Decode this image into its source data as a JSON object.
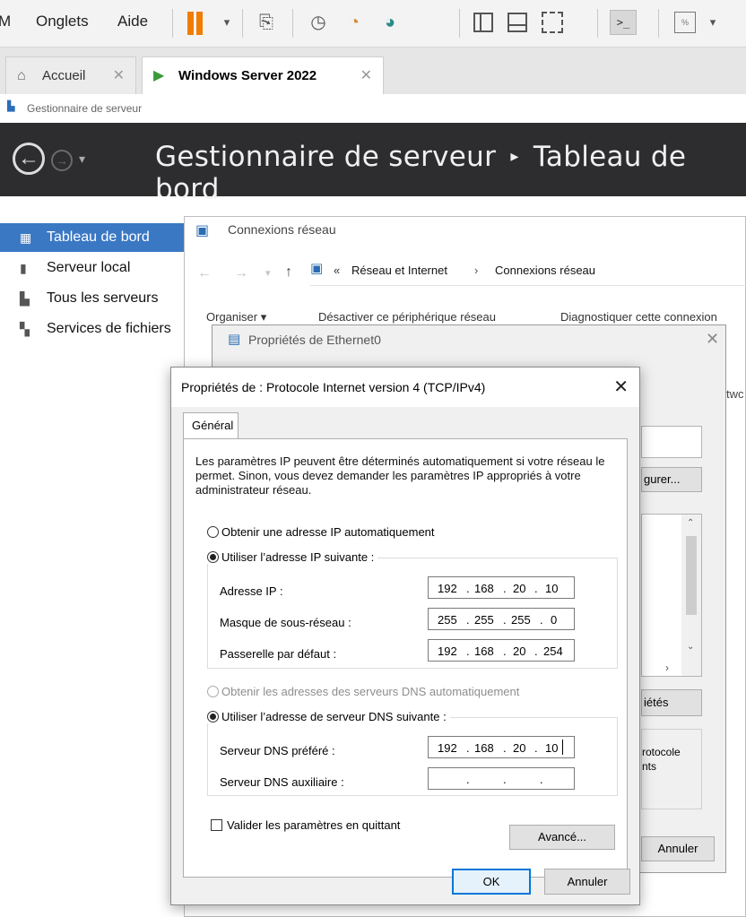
{
  "vmware": {
    "menu": [
      "M",
      "Onglets",
      "Aide"
    ],
    "tabs": [
      {
        "label": "Accueil"
      },
      {
        "label": "Windows Server 2022"
      }
    ]
  },
  "server_manager": {
    "window_title": "Gestionnaire de serveur",
    "title": "Gestionnaire de serveur",
    "separator": "▸",
    "page": "Tableau de bord",
    "sidebar": [
      {
        "label": "Tableau de bord",
        "active": true
      },
      {
        "label": "Serveur local"
      },
      {
        "label": "Tous les serveurs"
      },
      {
        "label": "Services de fichiers"
      }
    ]
  },
  "network_connections": {
    "title": "Connexions réseau",
    "breadcrumb": {
      "prefix": "«",
      "parent": "Réseau et Internet",
      "sep": "›",
      "current": "Connexions réseau"
    },
    "commands": [
      "Organiser ▾",
      "Désactiver ce périphérique réseau",
      "Diagnostiquer cette connexion"
    ],
    "edge_text": "twc"
  },
  "ethernet_props": {
    "title": "Propriétés de Ethernet0",
    "configure_partial": "gurer...",
    "properties_partial": "iétés",
    "desc_partial_1": "rotocole",
    "desc_partial_2": "nts",
    "cancel": "Annuler"
  },
  "ipv4": {
    "title": "Propriétés de : Protocole Internet version 4 (TCP/IPv4)",
    "tab": "Général",
    "description": "Les paramètres IP peuvent être déterminés automatiquement si votre réseau le permet. Sinon, vous devez demander les paramètres IP appropriés à votre administrateur réseau.",
    "ip_auto": "Obtenir une adresse IP automatiquement",
    "ip_manual": "Utiliser l’adresse IP suivante :",
    "ip_address_label": "Adresse IP :",
    "ip_address": [
      "192",
      "168",
      "20",
      "10"
    ],
    "mask_label": "Masque de sous-réseau :",
    "mask": [
      "255",
      "255",
      "255",
      "0"
    ],
    "gateway_label": "Passerelle par défaut :",
    "gateway": [
      "192",
      "168",
      "20",
      "254"
    ],
    "dns_auto": "Obtenir les adresses des serveurs DNS automatiquement",
    "dns_manual": "Utiliser l’adresse de serveur DNS suivante :",
    "dns_pref_label": "Serveur DNS préféré :",
    "dns_pref": [
      "192",
      "168",
      "20",
      "10"
    ],
    "dns_alt_label": "Serveur DNS auxiliaire :",
    "dns_alt": [
      "",
      "",
      "",
      ""
    ],
    "validate": "Valider les paramètres en quittant",
    "advanced": "Avancé...",
    "ok": "OK",
    "cancel": "Annuler"
  }
}
